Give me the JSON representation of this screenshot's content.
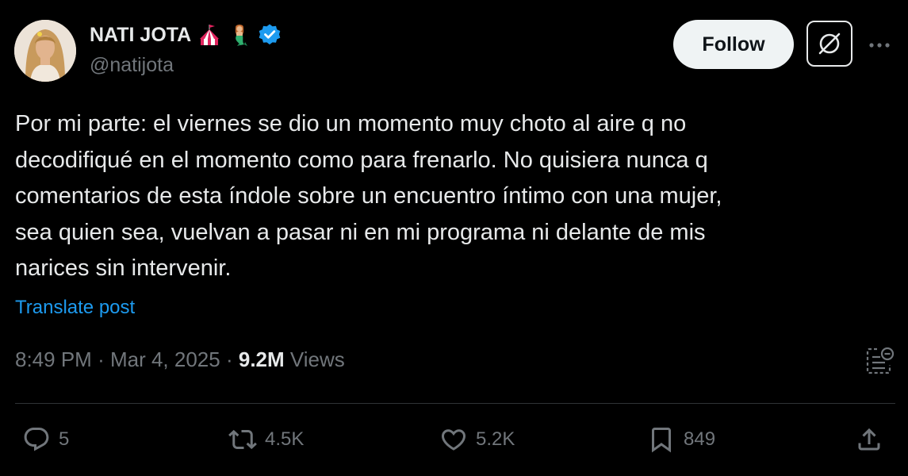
{
  "author": {
    "name": "NATI JOTA",
    "handle": "@natijota",
    "emojis": [
      "circus-tent",
      "merperson"
    ],
    "verified": true
  },
  "follow_label": "Follow",
  "post": {
    "lines": [
      "Por mi parte: el viernes se dio un momento muy choto al aire q no",
      "decodifiqué en el momento como para frenarlo. No quisiera nunca q",
      "comentarios de esta índole sobre un encuentro íntimo con una mujer,",
      "sea quien sea, vuelvan a pasar ni en mi programa ni delante de mis",
      "narices sin intervenir."
    ],
    "translate_label": "Translate post"
  },
  "meta": {
    "time": "8:49 PM",
    "date": "Mar 4, 2025",
    "separator": "·",
    "views_count": "9.2M",
    "views_label": "Views"
  },
  "actions": {
    "replies": "5",
    "reposts": "4.5K",
    "likes": "5.2K",
    "bookmarks": "849"
  },
  "colors": {
    "background": "#000000",
    "text": "#e7e9ea",
    "secondary": "#71767b",
    "link": "#1d9bf0",
    "verified": "#1d9bf0",
    "divider": "#2f3336"
  }
}
